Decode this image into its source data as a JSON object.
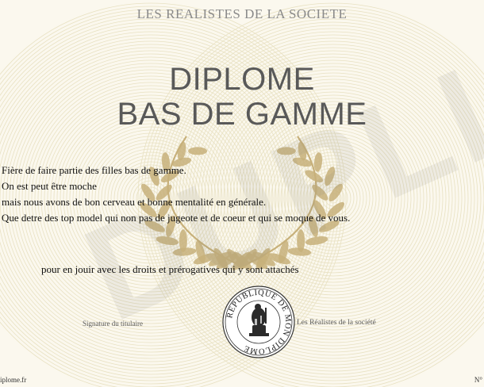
{
  "header": {
    "org_name": "LES REALISTES DE LA SOCIETE"
  },
  "title": {
    "line1": "DIPLOME",
    "line2": "BAS DE GAMME"
  },
  "body": {
    "lines": [
      "Fière de faire partie des filles bas de gamme.",
      "On est peut être moche",
      "mais nous avons de bon cerveau et bonne mentalité en générale.",
      "Que detre des  top model qui non pas de jugeote et de coeur et qui se moque de vous."
    ]
  },
  "rights_text": "pour en jouir avec les droits et prérogatives qui y sont attachés",
  "signatures": {
    "left": "Signature du titulaire",
    "right": "Les Réalistes de la société"
  },
  "seal": {
    "text": "REPUBLIQUE DE MON DIPLOME"
  },
  "watermark": "DUPLIC",
  "footer": {
    "left": "iplome.fr",
    "right": "N°"
  },
  "colors": {
    "laurel": "#c7b07a",
    "guilloche": "#e8e1c2",
    "title": "#595959"
  },
  "icons": {
    "emblem": "laurel-wreath-icon",
    "seal": "seal-icon"
  }
}
